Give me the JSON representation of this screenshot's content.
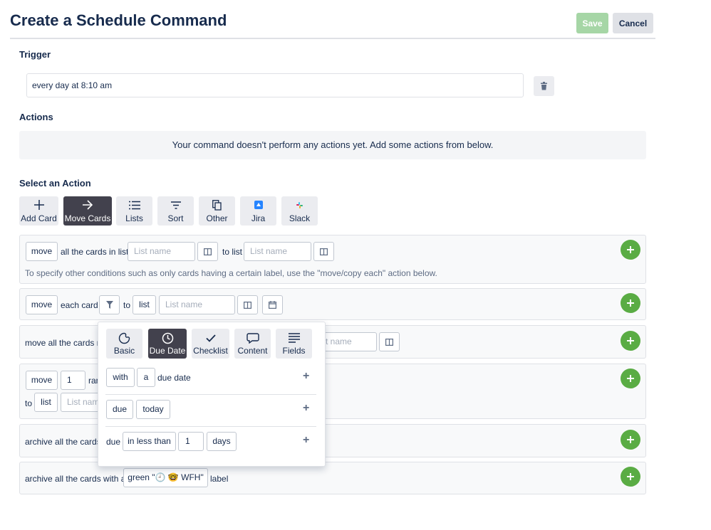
{
  "header": {
    "title": "Create a Schedule Command",
    "save_label": "Save",
    "cancel_label": "Cancel"
  },
  "trigger": {
    "label": "Trigger",
    "value": "every day at 8:10 am"
  },
  "actions": {
    "label": "Actions",
    "empty_message": "Your command doesn't perform any actions yet. Add some actions from below."
  },
  "select_action": {
    "label": "Select an Action",
    "tabs": [
      {
        "label": "Add Card",
        "icon": "plus-icon"
      },
      {
        "label": "Move Cards",
        "icon": "arrow-right-icon"
      },
      {
        "label": "Lists",
        "icon": "list-icon"
      },
      {
        "label": "Sort",
        "icon": "sort-icon"
      },
      {
        "label": "Other",
        "icon": "copy-icon"
      },
      {
        "label": "Jira",
        "icon": "jira-icon"
      },
      {
        "label": "Slack",
        "icon": "slack-icon"
      }
    ],
    "active_tab": "Move Cards"
  },
  "rows": {
    "r1": {
      "move": "move",
      "text1": "all the cards in list",
      "list_placeholder": "List name",
      "to_list": "to list",
      "list2_placeholder": "List name",
      "note": "To specify other conditions such as only cards having a certain label, use the \"move/copy each\" action below."
    },
    "r2": {
      "move": "move",
      "each_card": "each card",
      "to": "to",
      "list": "list",
      "list_placeholder": "List name"
    },
    "r3": {
      "text": "move all the cards m",
      "list_placeholder": "t name"
    },
    "r4": {
      "move": "move",
      "count": "1",
      "ran": "ran",
      "to": "to",
      "list": "list",
      "list_placeholder": "List nam"
    },
    "r5": {
      "text": "archive all the cards"
    },
    "r6": {
      "text": "archive all the cards with a",
      "label_value": "green \"🕘 🤓 WFH\"",
      "label_suffix": "label"
    }
  },
  "popup": {
    "tabs": [
      {
        "label": "Basic",
        "icon": "palette-icon"
      },
      {
        "label": "Due Date",
        "icon": "clock-icon"
      },
      {
        "label": "Checklist",
        "icon": "check-icon"
      },
      {
        "label": "Content",
        "icon": "comment-icon"
      },
      {
        "label": "Fields",
        "icon": "lines-icon"
      }
    ],
    "active_tab": "Due Date",
    "row1": {
      "with": "with",
      "a": "a",
      "text": "due date"
    },
    "row2": {
      "due": "due",
      "when": "today"
    },
    "row3": {
      "due": "due",
      "cond": "in less than",
      "count": "1",
      "unit": "days"
    }
  },
  "colors": {
    "accent_green": "#5aac44",
    "save_disabled": "#a6d6a6",
    "active_tab": "#42414d"
  }
}
